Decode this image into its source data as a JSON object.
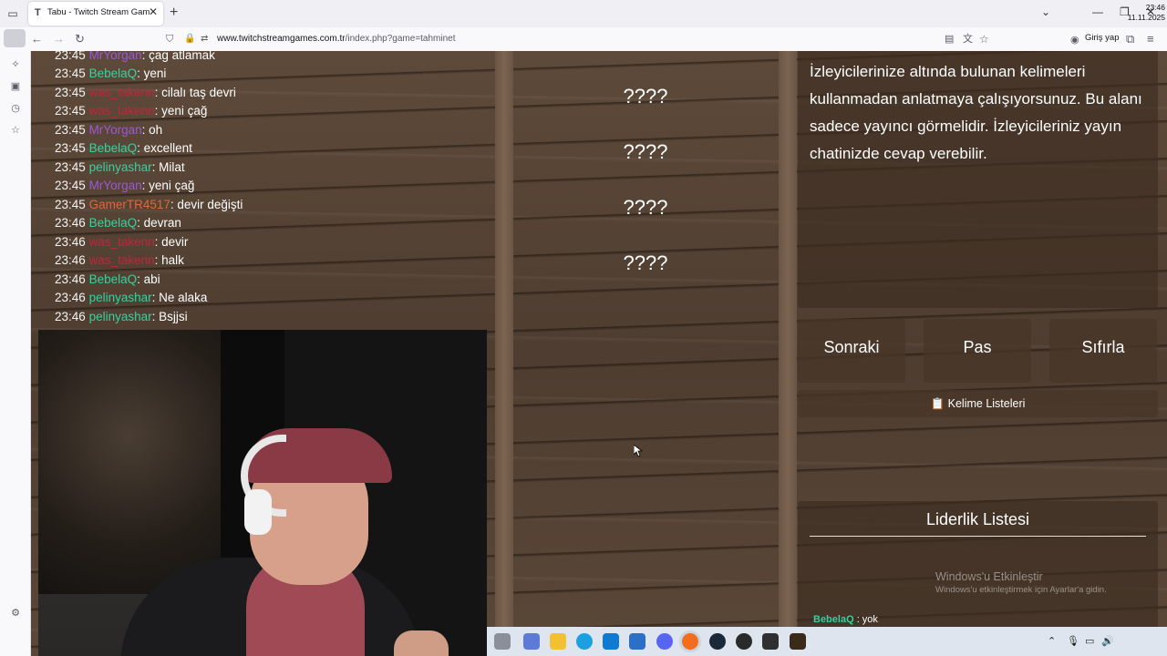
{
  "browser": {
    "tab_title": "Tabu - Twitch Stream Games",
    "tab_favicon": "T",
    "url_host": "www.twitchstreamgames.com.tr",
    "url_path": "/index.php?game=tahminet",
    "login_label": "Giriş yap"
  },
  "chat": {
    "lines": [
      {
        "time": "23:45",
        "user": "MrYorgan",
        "color": "#9b59d6",
        "msg": ": çag atlamak"
      },
      {
        "time": "23:45",
        "user": "BebelaQ",
        "color": "#36d1a0",
        "msg": ": yeni"
      },
      {
        "time": "23:45",
        "user": "was_takenn",
        "color": "#c0263a",
        "msg": ": cilalı taş devri"
      },
      {
        "time": "23:45",
        "user": "was_takenn",
        "color": "#c0263a",
        "msg": ": yeni çağ"
      },
      {
        "time": "23:45",
        "user": "MrYorgan",
        "color": "#9b59d6",
        "msg": ": oh"
      },
      {
        "time": "23:45",
        "user": "BebelaQ",
        "color": "#36d1a0",
        "msg": ": excellent"
      },
      {
        "time": "23:45",
        "user": "pelinyashar",
        "color": "#36d1a0",
        "msg": ": Milat"
      },
      {
        "time": "23:45",
        "user": "MrYorgan",
        "color": "#9b59d6",
        "msg": ": yeni çağ"
      },
      {
        "time": "23:45",
        "user": "GamerTR4517",
        "color": "#e0683a",
        "msg": ": devir değişti"
      },
      {
        "time": "23:46",
        "user": "BebelaQ",
        "color": "#36d1a0",
        "msg": ": devran"
      },
      {
        "time": "23:46",
        "user": "was_takenn",
        "color": "#c0263a",
        "msg": ": devir"
      },
      {
        "time": "23:46",
        "user": "was_takenn",
        "color": "#c0263a",
        "msg": ": halk"
      },
      {
        "time": "23:46",
        "user": "BebelaQ",
        "color": "#36d1a0",
        "msg": ": abi"
      },
      {
        "time": "23:46",
        "user": "pelinyashar",
        "color": "#36d1a0",
        "msg": ": Ne alaka"
      },
      {
        "time": "23:46",
        "user": "pelinyashar",
        "color": "#36d1a0",
        "msg": ": Bsjjsi"
      }
    ]
  },
  "words": [
    "????",
    "????",
    "????",
    "????"
  ],
  "rules_text": "İzleyicilerinize altında bulunan kelimeleri kullanmadan anlatmaya çalışıyorsunuz. Bu alanı sadece yayıncı görmelidir. İzleyicileriniz yayın chatinizde cevap verebilir.",
  "buttons": {
    "next": "Sonraki",
    "pass": "Pas",
    "reset": "Sıfırla",
    "word_lists": "Kelime Listeleri",
    "word_lists_icon": "📋"
  },
  "leaderboard": {
    "title": "Liderlik Listesi",
    "entries": [
      {
        "name": "BebelaQ",
        "text": " : yok"
      }
    ]
  },
  "activation": {
    "title": "Windows'u Etkinleştir",
    "subtitle": "Windows'u etkinleştirmek için Ayarlar'a gidin."
  },
  "clock": {
    "time": "23:46",
    "date": "11.11.2025"
  }
}
